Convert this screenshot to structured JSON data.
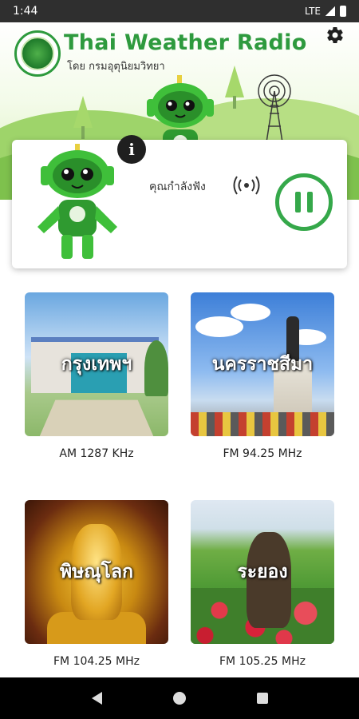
{
  "status_bar": {
    "time": "1:44",
    "network": "LTE"
  },
  "header": {
    "title": "Thai Weather Radio",
    "subtitle": "โดย กรมอุตุนิยมวิทยา"
  },
  "now_playing": {
    "status_text": "คุณกำลังฟัง",
    "info_label": "i"
  },
  "stations": [
    {
      "name": "กรุงเทพฯ",
      "frequency": "AM 1287 KHz"
    },
    {
      "name": "นครราชสีมา",
      "frequency": "FM 94.25 MHz"
    },
    {
      "name": "พิษณุโลก",
      "frequency": "FM 104.25 MHz"
    },
    {
      "name": "ระยอง",
      "frequency": "FM 105.25 MHz"
    }
  ],
  "colors": {
    "brand_green": "#35a84a",
    "title_green": "#2e9a3e"
  }
}
